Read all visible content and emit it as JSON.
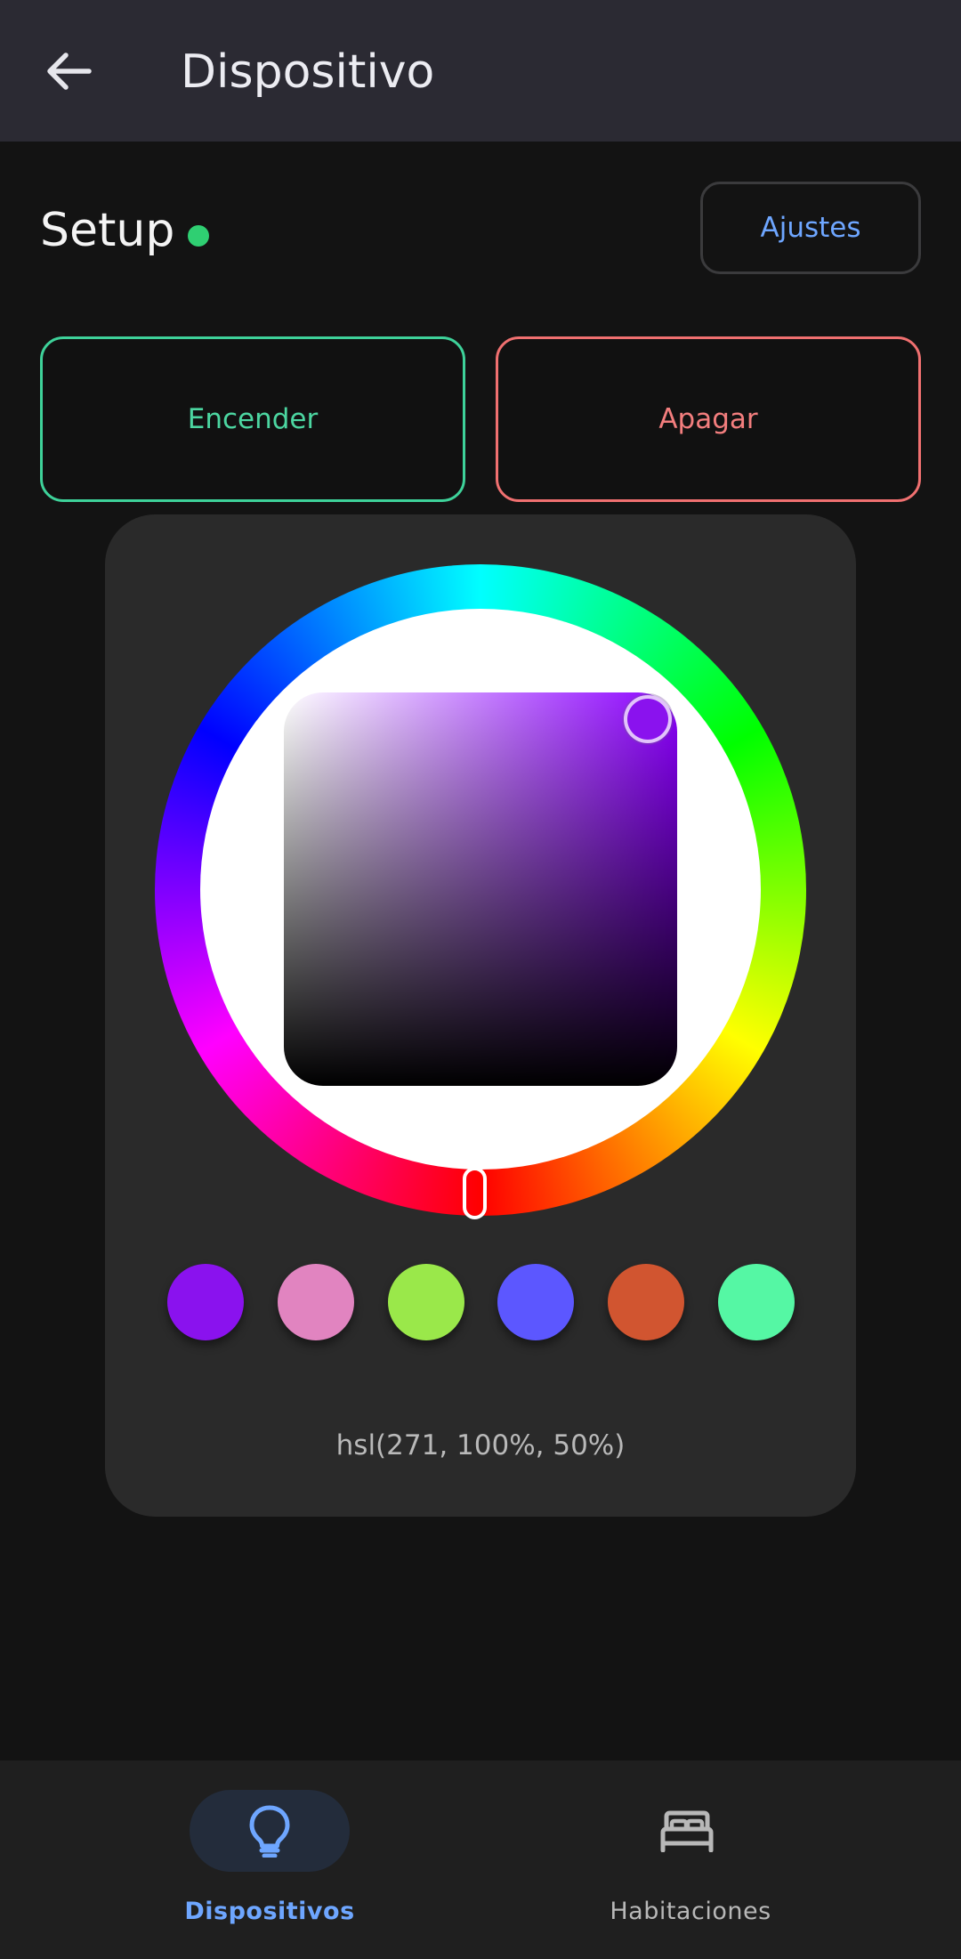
{
  "app_bar": {
    "title": "Dispositivo",
    "back_icon": "arrow-left-icon"
  },
  "device": {
    "name": "Setup",
    "status": "online",
    "status_color": "#2fcf72",
    "settings_label": "Ajustes"
  },
  "power": {
    "on_label": "Encender",
    "off_label": "Apagar",
    "on_color": "#4cd6a1",
    "off_color": "#f37e7e"
  },
  "color_picker": {
    "hue": 271,
    "saturation": 100,
    "lightness": 50,
    "value_text": "hsl(271, 100%, 50%)",
    "swatches": [
      {
        "color": "#8a12ee"
      },
      {
        "color": "#e184c0"
      },
      {
        "color": "#9ae84a"
      },
      {
        "color": "#5c57ff"
      },
      {
        "color": "#d15530"
      },
      {
        "color": "#55f7a4"
      }
    ]
  },
  "bottom_nav": {
    "items": [
      {
        "label": "Dispositivos",
        "icon": "lightbulb-icon",
        "active": true
      },
      {
        "label": "Habitaciones",
        "icon": "bed-icon",
        "active": false
      }
    ],
    "active_color": "#6ea6ff"
  }
}
